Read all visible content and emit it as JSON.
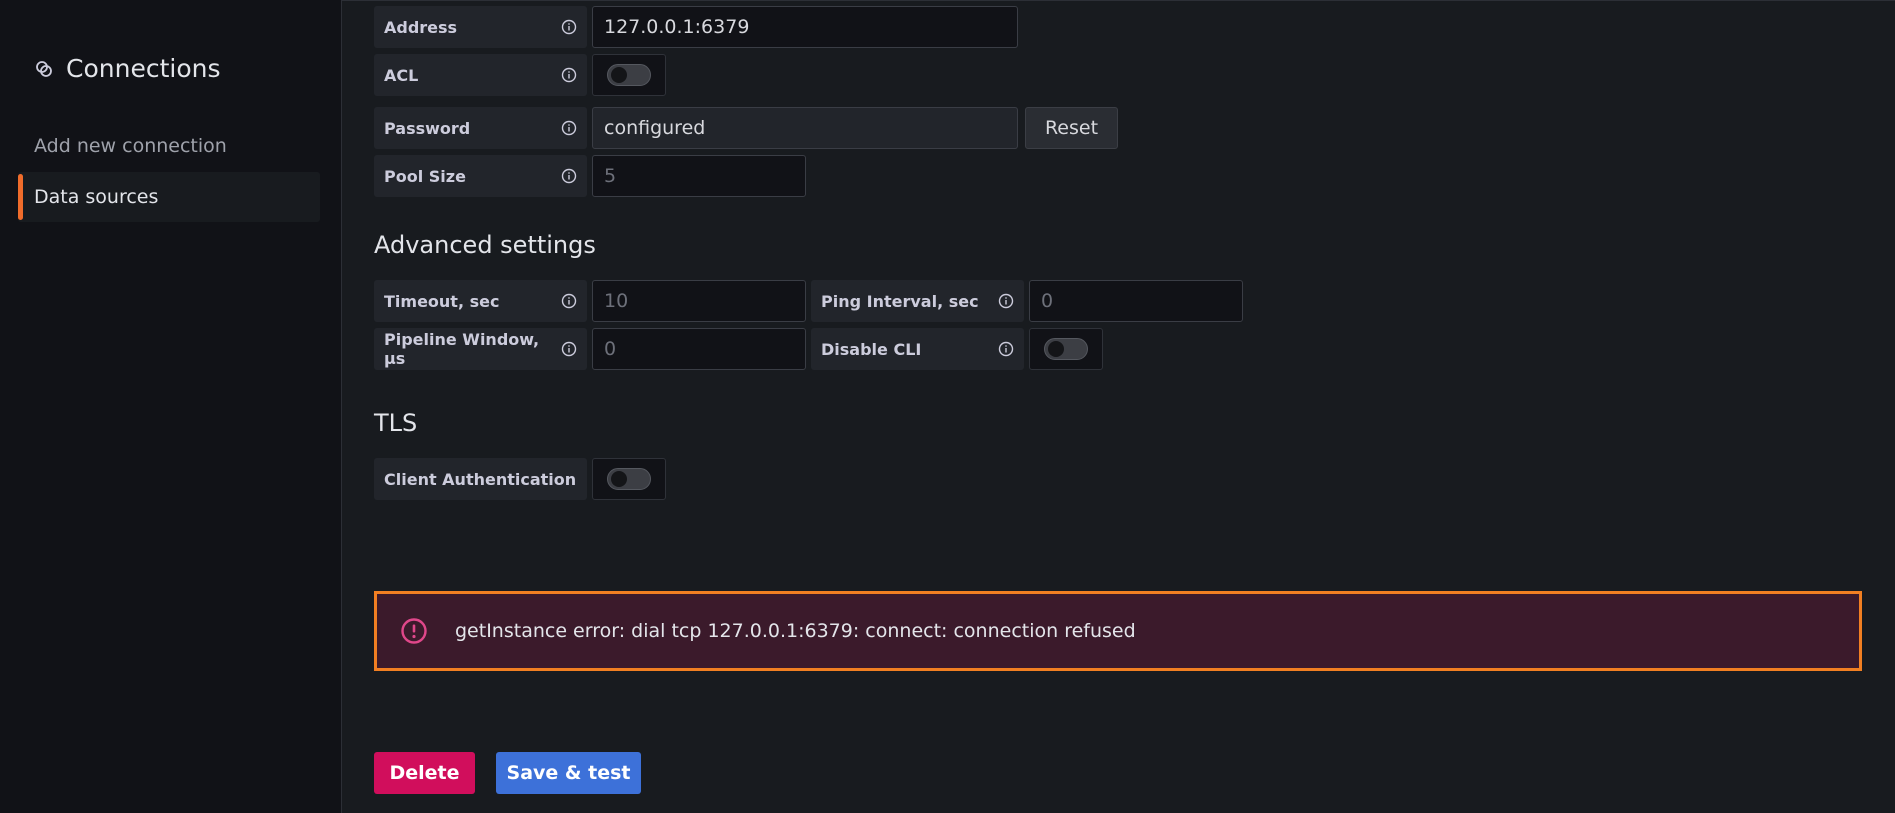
{
  "sidebar": {
    "title": "Connections",
    "title_icon": "connections-icon",
    "items": [
      {
        "label": "Add new connection",
        "active": false
      },
      {
        "label": "Data sources",
        "active": true
      }
    ]
  },
  "connection": {
    "address": {
      "label": "Address",
      "value": "127.0.0.1:6379"
    },
    "acl": {
      "label": "ACL",
      "enabled": false
    },
    "password": {
      "label": "Password",
      "value": "configured",
      "reset_label": "Reset"
    },
    "pool_size": {
      "label": "Pool Size",
      "placeholder": "5"
    }
  },
  "advanced": {
    "title": "Advanced settings",
    "timeout": {
      "label": "Timeout, sec",
      "placeholder": "10"
    },
    "ping_interval": {
      "label": "Ping Interval, sec",
      "placeholder": "0"
    },
    "pipeline_window": {
      "label": "Pipeline Window, μs",
      "placeholder": "0"
    },
    "disable_cli": {
      "label": "Disable CLI",
      "enabled": false
    }
  },
  "tls": {
    "title": "TLS",
    "client_auth": {
      "label": "Client Authentication",
      "enabled": false
    }
  },
  "alert": {
    "message": "getInstance error: dial tcp 127.0.0.1:6379: connect: connection refused",
    "icon": "exclamation-circle-icon"
  },
  "actions": {
    "delete_label": "Delete",
    "save_label": "Save & test"
  },
  "colors": {
    "accent": "#f06c2b",
    "alert_border": "#f17f22",
    "alert_bg": "#3b1a2b",
    "error_icon": "#e0478a",
    "delete": "#d10e5c",
    "primary": "#3d71d9"
  }
}
